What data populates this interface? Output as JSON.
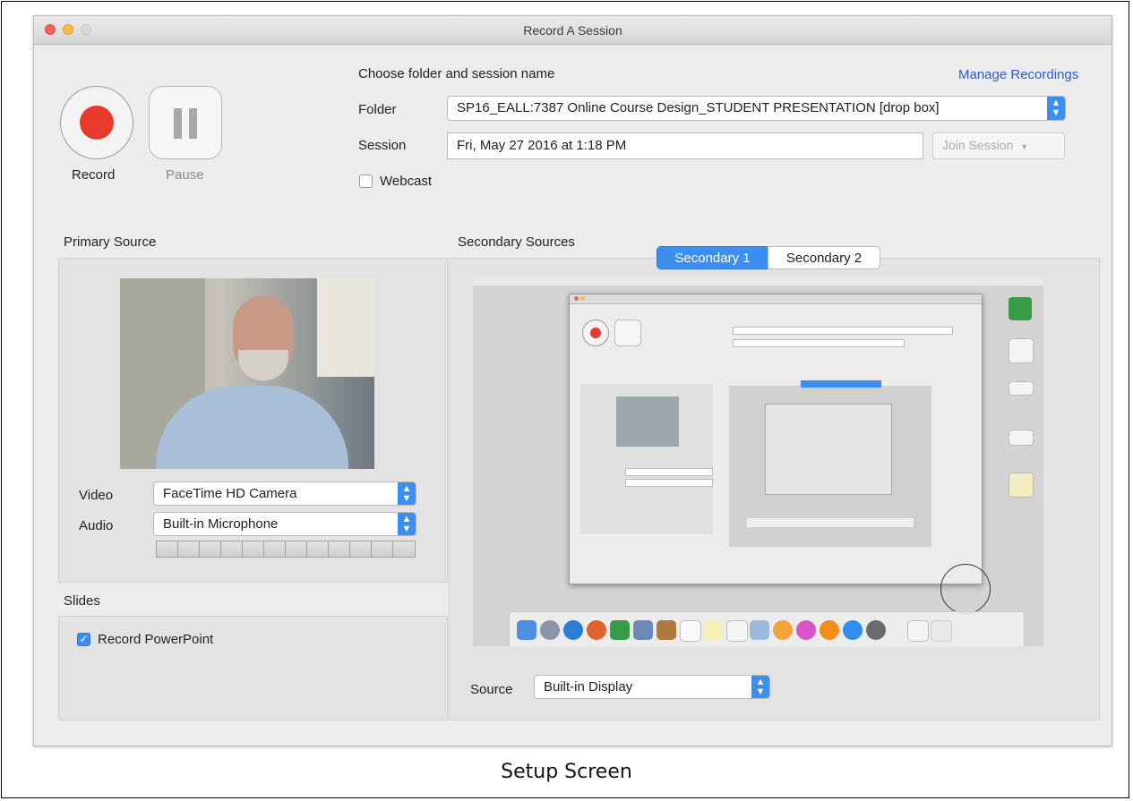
{
  "window": {
    "title": "Record A Session"
  },
  "controls": {
    "record_label": "Record",
    "pause_label": "Pause"
  },
  "session": {
    "heading": "Choose folder and session name",
    "manage_link": "Manage Recordings",
    "folder_label": "Folder",
    "folder_value": "SP16_EALL:7387 Online Course Design_STUDENT PRESENTATION [drop box]",
    "session_label": "Session",
    "session_value": "Fri, May 27 2016 at 1:18 PM",
    "join_label": "Join Session",
    "webcast_label": "Webcast",
    "webcast_checked": false
  },
  "primary": {
    "heading": "Primary Source",
    "video_label": "Video",
    "video_value": "FaceTime HD Camera",
    "audio_label": "Audio",
    "audio_value": "Built-in Microphone",
    "audio_level": 0
  },
  "slides": {
    "heading": "Slides",
    "record_ppt_label": "Record PowerPoint",
    "record_ppt_checked": true
  },
  "secondary": {
    "heading": "Secondary Sources",
    "tabs": [
      {
        "label": "Secondary 1",
        "active": true
      },
      {
        "label": "Secondary 2",
        "active": false
      }
    ],
    "source_label": "Source",
    "source_value": "Built-in Display"
  },
  "caption": "Setup Screen",
  "colors": {
    "accent": "#3d8ef2",
    "record": "#e8392d",
    "window_bg": "#ececec"
  }
}
